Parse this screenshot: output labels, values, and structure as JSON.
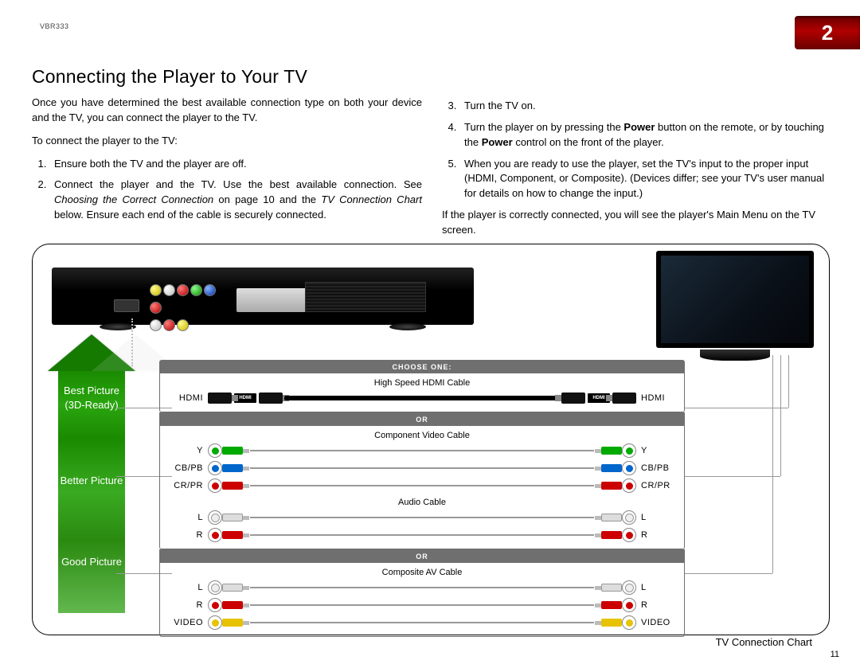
{
  "model": "VBR333",
  "chapter_number": "2",
  "section_title": "Connecting the Player to Your TV",
  "left_col": {
    "intro": "Once you have determined the best available connection type on both your device and the TV, you can connect the player to the TV.",
    "lead": "To connect the player to the TV:",
    "step1": "Ensure both the TV and the player are off.",
    "step2_a": "Connect the player and the TV. Use the best available connection. See ",
    "step2_i1": "Choosing the Correct Connection",
    "step2_b": " on page 10 and the ",
    "step2_i2": "TV Connection Chart",
    "step2_c": " below. Ensure each end of the cable is securely connected."
  },
  "right_col": {
    "step3": "Turn the TV on.",
    "step4_a": "Turn the player on by pressing the ",
    "step4_b1": "Power",
    "step4_c": " button on the remote, or by touching the ",
    "step4_b2": "Power",
    "step4_d": " control on the front of the player.",
    "step5": "When you are ready to use the player, set the TV's input to the proper input (HDMI, Component, or Composite). (Devices differ; see your TV's user manual for details on how to change the input.)",
    "closing": "If the player is correctly connected, you will see the player's Main Menu on the TV screen."
  },
  "arrow": {
    "best_l1": "Best Picture",
    "best_l2": "(3D-Ready)",
    "better": "Better Picture",
    "good": "Good Picture"
  },
  "conn": {
    "choose": "CHOOSE ONE:",
    "or": "OR",
    "hdmi_title": "High Speed HDMI Cable",
    "hdmi_lbl": "HDMI",
    "hdmi_logo": "HDMI",
    "comp_title": "Component Video Cable",
    "audio_title": "Audio Cable",
    "composite_title": "Composite AV Cable",
    "y": "Y",
    "cbpb": "CB/PB",
    "crpr": "CR/PR",
    "l": "L",
    "r": "R",
    "video": "VIDEO"
  },
  "chart_caption": "TV Connection Chart",
  "page_number": "11"
}
